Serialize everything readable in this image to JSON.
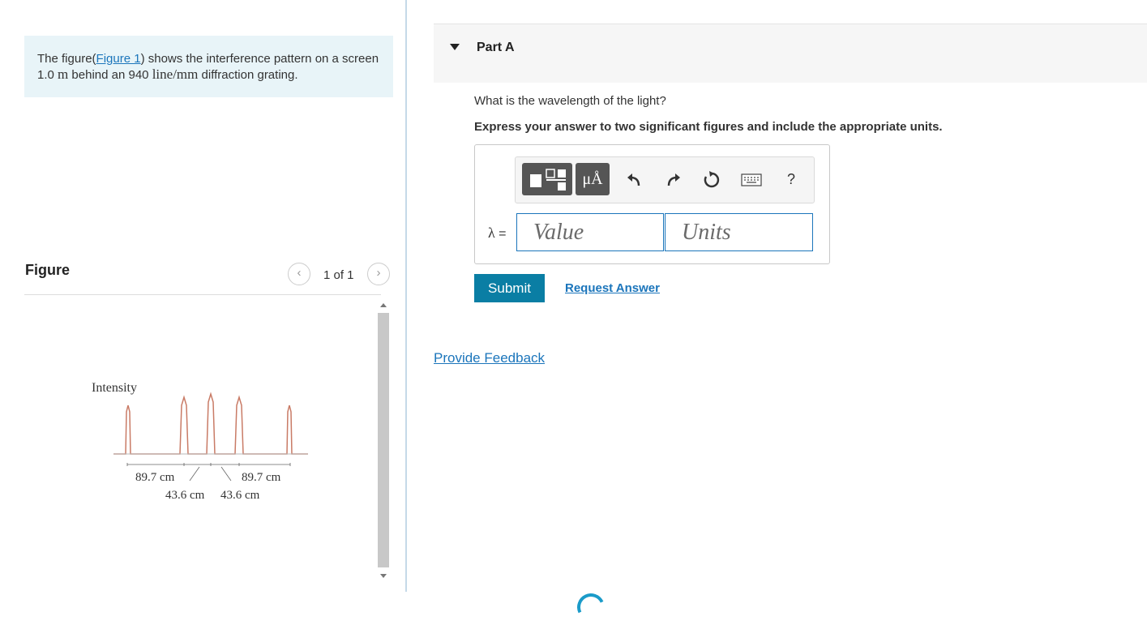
{
  "problem": {
    "text_before_link": "The figure(",
    "link_text": "Figure 1",
    "text_after_link": ") shows the interference pattern on a screen 1.0 ",
    "unit_m": "m",
    "text_mid": " behind an 940 ",
    "unit_line_mm": "line/mm",
    "text_end": " diffraction grating."
  },
  "figure_panel": {
    "title": "Figure",
    "prev_icon": "chevron-left-icon",
    "next_icon": "chevron-right-icon",
    "page_count": "1 of 1"
  },
  "figure": {
    "ylabel": "Intensity",
    "dim_outer_left": "89.7 cm",
    "dim_outer_right": "89.7 cm",
    "dim_inner_left": "43.6 cm",
    "dim_inner_right": "43.6 cm",
    "line_color": "#c97b66"
  },
  "part": {
    "toggle_icon": "triangle-down-icon",
    "title": "Part A"
  },
  "question": "What is the wavelength of the light?",
  "instruction": "Express your answer to two significant figures and include the appropriate units.",
  "toolbar": {
    "templates_icon": "templates-icon",
    "units_label": "μÅ",
    "undo_icon": "undo-icon",
    "redo_icon": "redo-icon",
    "reset_icon": "reset-icon",
    "keyboard_icon": "keyboard-icon",
    "help_label": "?"
  },
  "answer": {
    "symbol": "λ",
    "equals": " =",
    "value_placeholder": "Value",
    "units_placeholder": "Units"
  },
  "submit_label": "Submit",
  "request_answer_label": "Request Answer",
  "feedback_label": "Provide Feedback",
  "colors": {
    "accent": "#0a7ea4",
    "link": "#1b75bb",
    "problem_bg": "#e8f4f8"
  }
}
